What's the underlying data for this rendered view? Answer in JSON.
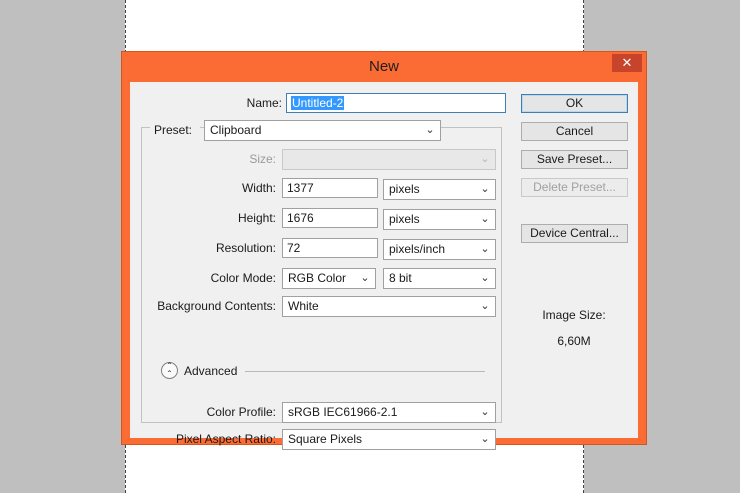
{
  "dialog": {
    "title": "New",
    "close_glyph": "✕"
  },
  "form": {
    "name_label": "Name:",
    "name_value": "Untitled-2",
    "preset_label": "Preset:",
    "preset_value": "Clipboard",
    "size_label": "Size:",
    "size_value": "",
    "width_label": "Width:",
    "width_value": "1377",
    "width_unit": "pixels",
    "height_label": "Height:",
    "height_value": "1676",
    "height_unit": "pixels",
    "resolution_label": "Resolution:",
    "resolution_value": "72",
    "resolution_unit": "pixels/inch",
    "color_mode_label": "Color Mode:",
    "color_mode_value": "RGB Color",
    "bit_depth_value": "8 bit",
    "background_label": "Background Contents:",
    "background_value": "White",
    "advanced_label": "Advanced",
    "color_profile_label": "Color Profile:",
    "color_profile_value": "sRGB IEC61966-2.1",
    "pixel_aspect_label": "Pixel Aspect Ratio:",
    "pixel_aspect_value": "Square Pixels"
  },
  "buttons": {
    "ok": "OK",
    "cancel": "Cancel",
    "save_preset": "Save Preset...",
    "delete_preset": "Delete Preset...",
    "device_central": "Device Central..."
  },
  "info": {
    "image_size_label": "Image Size:",
    "image_size_value": "6,60M"
  },
  "icons": {
    "chevron": "chevron-down-icon",
    "advanced_toggle": "double-chevron-up-icon"
  },
  "colors": {
    "title_bar": "#fb6c34",
    "close_button": "#c7442b",
    "selection": "#3399ff"
  }
}
